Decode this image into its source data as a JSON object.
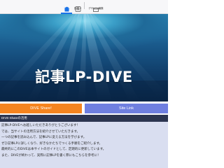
{
  "toolbar": {
    "items": [
      {
        "label": "下書",
        "icon": "home-icon",
        "active": true
      },
      {
        "label": "投稿 ▾",
        "icon": "post-icon",
        "active": false
      },
      {
        "label": "デザイン編集",
        "icon": "design-icon",
        "active": false
      }
    ]
  },
  "hero": {
    "title": "記事LP-DIVE"
  },
  "buttons": {
    "dive": "DIVE Share!",
    "site": "Site Link"
  },
  "info": {
    "header": "DIVE-Shareの活用",
    "lines": [
      "記事LP-DIVEへお越しいただきありがとうございます！",
      "では、当サイトの活用方法を紹介させていただきます。",
      "一つの記事を読み込んで、記事LPに変える方法を学びます。",
      "ぜひ記事LPに詳しくなり、好きなかたちでつくる手順をご紹介します。",
      "最終的にこのDIVEは本サイトのガイドとして、定期的に更新しています。",
      "また、DIVEが終わって、実際に記事LPを書く際にもこちらを参考に！"
    ]
  },
  "colors": {
    "dive_button": "#f5841f",
    "site_button": "#6f7fe0",
    "active_tab": "#1a73e8"
  }
}
